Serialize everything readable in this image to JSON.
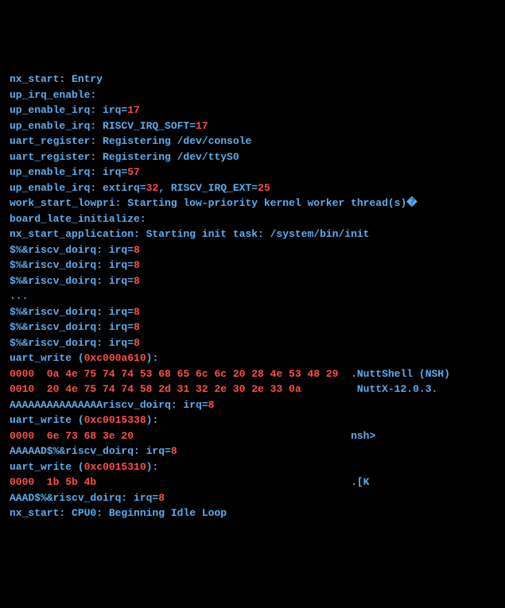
{
  "lines": [
    {
      "segments": [
        {
          "cls": "cyan",
          "t": "nx_start: Entry"
        }
      ]
    },
    {
      "segments": [
        {
          "cls": "cyan",
          "t": "up_irq_enable:"
        }
      ]
    },
    {
      "segments": [
        {
          "cls": "cyan",
          "t": "up_enable_irq: irq="
        },
        {
          "cls": "red",
          "t": "17"
        }
      ]
    },
    {
      "segments": [
        {
          "cls": "cyan",
          "t": "up_enable_irq: RISCV_IRQ_SOFT="
        },
        {
          "cls": "red",
          "t": "17"
        }
      ]
    },
    {
      "segments": [
        {
          "cls": "cyan",
          "t": "uart_register: Registering /dev/console"
        }
      ]
    },
    {
      "segments": [
        {
          "cls": "cyan",
          "t": "uart_register: Registering /dev/ttyS0"
        }
      ]
    },
    {
      "segments": [
        {
          "cls": "cyan",
          "t": "up_enable_irq: irq="
        },
        {
          "cls": "red",
          "t": "57"
        }
      ]
    },
    {
      "segments": [
        {
          "cls": "cyan",
          "t": "up_enable_irq: extirq="
        },
        {
          "cls": "red",
          "t": "32"
        },
        {
          "cls": "cyan",
          "t": ", RISCV_IRQ_EXT="
        },
        {
          "cls": "red",
          "t": "25"
        }
      ]
    },
    {
      "segments": [
        {
          "cls": "cyan",
          "t": "work_start_lowpri: Starting low-priority kernel worker thread(s)�"
        }
      ]
    },
    {
      "segments": [
        {
          "cls": "cyan",
          "t": "board_late_initialize:"
        }
      ]
    },
    {
      "segments": [
        {
          "cls": "cyan",
          "t": "nx_start_application: Starting init task: /system/bin/init"
        }
      ]
    },
    {
      "segments": [
        {
          "cls": "cyan",
          "t": "$%&riscv_doirq: irq="
        },
        {
          "cls": "red",
          "t": "8"
        }
      ]
    },
    {
      "segments": [
        {
          "cls": "cyan",
          "t": "$%&riscv_doirq: irq="
        },
        {
          "cls": "red",
          "t": "8"
        }
      ]
    },
    {
      "segments": [
        {
          "cls": "cyan",
          "t": "$%&riscv_doirq: irq="
        },
        {
          "cls": "red",
          "t": "8"
        }
      ]
    },
    {
      "segments": [
        {
          "cls": "cyan",
          "t": "..."
        }
      ]
    },
    {
      "segments": [
        {
          "cls": "cyan",
          "t": "$%&riscv_doirq: irq="
        },
        {
          "cls": "red",
          "t": "8"
        }
      ]
    },
    {
      "segments": [
        {
          "cls": "cyan",
          "t": "$%&riscv_doirq: irq="
        },
        {
          "cls": "red",
          "t": "8"
        }
      ]
    },
    {
      "segments": [
        {
          "cls": "cyan",
          "t": "$%&riscv_doirq: irq="
        },
        {
          "cls": "red",
          "t": "8"
        }
      ]
    },
    {
      "segments": [
        {
          "cls": "cyan",
          "t": "uart_write ("
        },
        {
          "cls": "red",
          "t": "0xc000a610"
        },
        {
          "cls": "cyan",
          "t": "):"
        }
      ]
    },
    {
      "segments": [
        {
          "cls": "red",
          "t": "0000  0a 4e 75 74 74 53 68 65 6c 6c 20 28 4e 53 48 29  "
        },
        {
          "cls": "cyan",
          "t": ".NuttShell (NSH)"
        }
      ]
    },
    {
      "segments": [
        {
          "cls": "red",
          "t": "0010  20 4e 75 74 74 58 2d 31 32 2e 30 2e 33 0a        "
        },
        {
          "cls": "cyan",
          "t": " NuttX-12.0.3."
        }
      ]
    },
    {
      "segments": [
        {
          "cls": "cyan",
          "t": "AAAAAAAAAAAAAAAriscv_doirq: irq="
        },
        {
          "cls": "red",
          "t": "8"
        }
      ]
    },
    {
      "segments": [
        {
          "cls": "cyan",
          "t": "uart_write ("
        },
        {
          "cls": "red",
          "t": "0xc0015338"
        },
        {
          "cls": "cyan",
          "t": "):"
        }
      ]
    },
    {
      "segments": [
        {
          "cls": "red",
          "t": "0000  6e 73 68 3e 20                                   "
        },
        {
          "cls": "cyan",
          "t": "nsh>"
        }
      ]
    },
    {
      "segments": [
        {
          "cls": "cyan",
          "t": "AAAAAD$%&riscv_doirq: irq="
        },
        {
          "cls": "red",
          "t": "8"
        }
      ]
    },
    {
      "segments": [
        {
          "cls": "cyan",
          "t": "uart_write ("
        },
        {
          "cls": "red",
          "t": "0xc0015310"
        },
        {
          "cls": "cyan",
          "t": "):"
        }
      ]
    },
    {
      "segments": [
        {
          "cls": "red",
          "t": "0000  1b 5b 4b                                         "
        },
        {
          "cls": "cyan",
          "t": ".[K"
        }
      ]
    },
    {
      "segments": [
        {
          "cls": "cyan",
          "t": "AAAD$%&riscv_doirq: irq="
        },
        {
          "cls": "red",
          "t": "8"
        }
      ]
    },
    {
      "segments": [
        {
          "cls": "cyan",
          "t": "nx_start: CPU0: Beginning Idle Loop"
        }
      ]
    }
  ]
}
